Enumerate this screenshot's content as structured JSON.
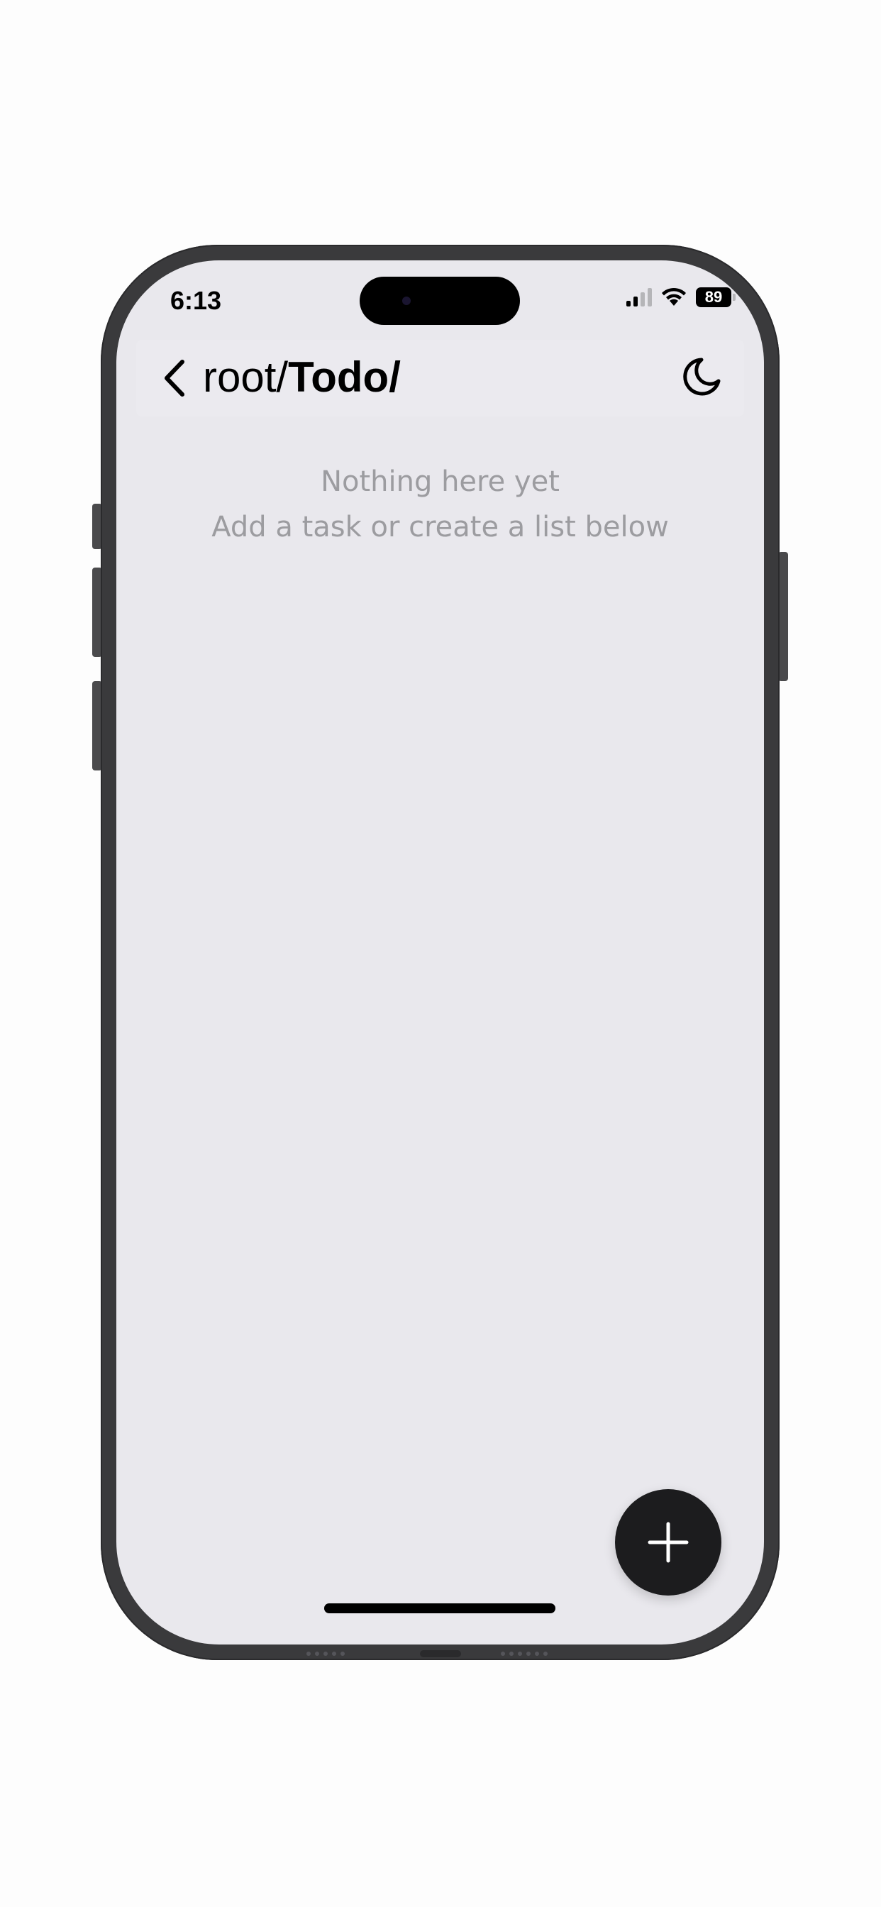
{
  "status_bar": {
    "time": "6:13",
    "battery_level": "89",
    "signal_bars": 2,
    "wifi": true
  },
  "nav": {
    "back_icon": "chevron-left-icon",
    "breadcrumb_parent": "root/",
    "breadcrumb_current": "Todo/",
    "theme_icon": "moon-icon"
  },
  "empty_state": {
    "title": "Nothing here yet",
    "subtitle": "Add a task or create a list below"
  },
  "fab": {
    "icon": "plus-icon"
  },
  "colors": {
    "background": "#e9e8ed",
    "fab": "#1c1c1e",
    "muted_text": "#9c9ca0",
    "frame": "#3a3a3c"
  }
}
